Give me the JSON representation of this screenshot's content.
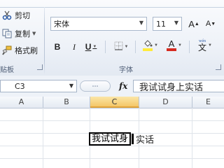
{
  "clipboard": {
    "cut_label": "剪切",
    "copy_label": "复制",
    "format_painter_label": "格式刷",
    "group_label": "贴板"
  },
  "font_group": {
    "font_name": "宋体",
    "font_size": "11",
    "grow_font": "A",
    "shrink_font": "A",
    "bold": "B",
    "italic": "I",
    "underline": "U",
    "font_color_glyph": "A",
    "wen_glyph": "文",
    "group_label": "字体",
    "font_color": "#d62a1f",
    "fill_color": "#ffeb3b"
  },
  "formula_bar": {
    "name_box": "C3",
    "fx_label": "fx",
    "content": "我试试身上实话"
  },
  "grid": {
    "columns": [
      "A",
      "B",
      "C",
      "D",
      "E"
    ],
    "active_column": "C",
    "editing_selected": "我试试身",
    "editing_rest": "实话"
  }
}
